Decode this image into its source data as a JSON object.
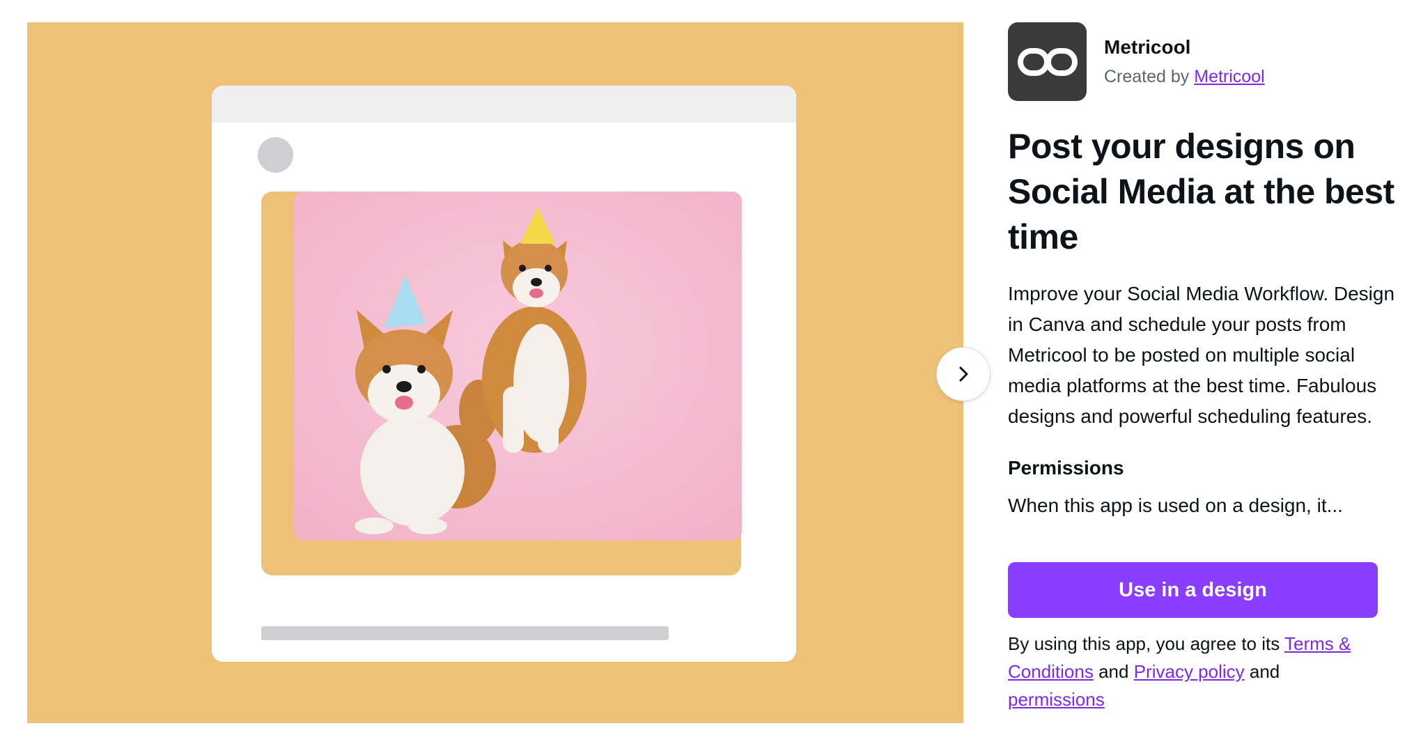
{
  "app": {
    "name": "Metricool",
    "created_by_prefix": "Created by",
    "creator": "Metricool",
    "icon": "infinity-loop-logo"
  },
  "headline": "Post your designs on Social Media at the best time",
  "description": "Improve your Social Media Workflow. Design in Canva and schedule your posts from Metricool to be posted on multiple social media platforms at the best time. Fabulous designs and powerful scheduling features.",
  "permissions": {
    "heading": "Permissions",
    "text": "When this app is used on a design, it..."
  },
  "cta": {
    "label": "Use in a design"
  },
  "legal": {
    "prefix": "By using this app, you agree to its",
    "terms": "Terms & Conditions",
    "and1": "and",
    "privacy": "Privacy policy",
    "and2": "and",
    "permissions": "permissions"
  },
  "carousel": {
    "next_icon": "chevron-right-icon"
  },
  "colors": {
    "preview_bg": "#eec276",
    "photo_bg": "#f5bdd1",
    "accent": "#8b3dff",
    "link": "#7d2ae8",
    "icon_bg": "#3a3a3a"
  }
}
